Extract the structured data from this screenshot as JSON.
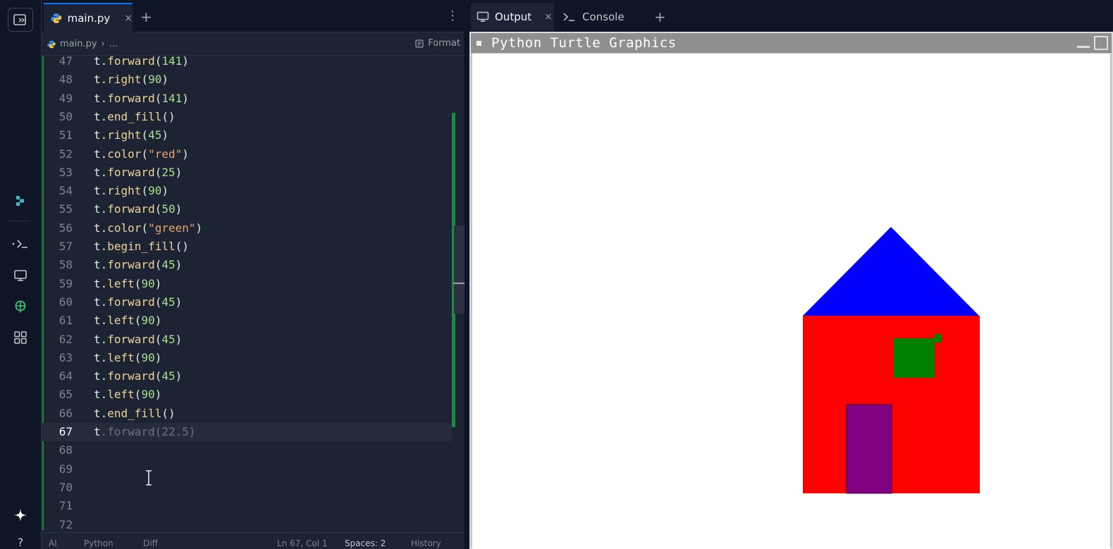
{
  "rail": {
    "icons": [
      "file-tree-icon",
      "replit-agent-icon",
      "shell-icon",
      "preview-icon",
      "web-globe-icon",
      "all-tools-icon",
      "sparkle-icon",
      "help-icon"
    ]
  },
  "editor": {
    "tab": {
      "label": "main.py",
      "close": "×"
    },
    "tab_add": "+",
    "menu": "⋮",
    "breadcrumb": {
      "file": "main.py",
      "sep": "›",
      "rest": "..."
    },
    "format_label": "Format",
    "lines": [
      {
        "n": "47",
        "parts": [
          [
            "obj",
            "t."
          ],
          [
            "fn",
            "forward"
          ],
          [
            "obj",
            "("
          ],
          [
            "num",
            "141"
          ],
          [
            "obj",
            ")"
          ]
        ]
      },
      {
        "n": "48",
        "parts": [
          [
            "obj",
            "t."
          ],
          [
            "fn",
            "right"
          ],
          [
            "obj",
            "("
          ],
          [
            "num",
            "90"
          ],
          [
            "obj",
            ")"
          ]
        ]
      },
      {
        "n": "49",
        "parts": [
          [
            "obj",
            "t."
          ],
          [
            "fn",
            "forward"
          ],
          [
            "obj",
            "("
          ],
          [
            "num",
            "141"
          ],
          [
            "obj",
            ")"
          ]
        ]
      },
      {
        "n": "50",
        "parts": [
          [
            "obj",
            "t."
          ],
          [
            "fn",
            "end_fill"
          ],
          [
            "obj",
            "()"
          ]
        ]
      },
      {
        "n": "51",
        "parts": [
          [
            "obj",
            "t."
          ],
          [
            "fn",
            "right"
          ],
          [
            "obj",
            "("
          ],
          [
            "num",
            "45"
          ],
          [
            "obj",
            ")"
          ]
        ]
      },
      {
        "n": "52",
        "parts": [
          [
            "obj",
            "t."
          ],
          [
            "fn",
            "color"
          ],
          [
            "obj",
            "("
          ],
          [
            "str",
            "\"red\""
          ],
          [
            "obj",
            ")"
          ]
        ]
      },
      {
        "n": "53",
        "parts": [
          [
            "obj",
            "t."
          ],
          [
            "fn",
            "forward"
          ],
          [
            "obj",
            "("
          ],
          [
            "num",
            "25"
          ],
          [
            "obj",
            ")"
          ]
        ]
      },
      {
        "n": "54",
        "parts": [
          [
            "obj",
            "t."
          ],
          [
            "fn",
            "right"
          ],
          [
            "obj",
            "("
          ],
          [
            "num",
            "90"
          ],
          [
            "obj",
            ")"
          ]
        ]
      },
      {
        "n": "55",
        "parts": [
          [
            "obj",
            "t."
          ],
          [
            "fn",
            "forward"
          ],
          [
            "obj",
            "("
          ],
          [
            "num",
            "50"
          ],
          [
            "obj",
            ")"
          ]
        ]
      },
      {
        "n": "56",
        "parts": [
          [
            "obj",
            "t."
          ],
          [
            "fn",
            "color"
          ],
          [
            "obj",
            "("
          ],
          [
            "str",
            "\"green\""
          ],
          [
            "obj",
            ")"
          ]
        ]
      },
      {
        "n": "57",
        "parts": [
          [
            "obj",
            "t."
          ],
          [
            "fn",
            "begin_fill"
          ],
          [
            "obj",
            "()"
          ]
        ]
      },
      {
        "n": "58",
        "parts": [
          [
            "obj",
            "t."
          ],
          [
            "fn",
            "forward"
          ],
          [
            "obj",
            "("
          ],
          [
            "num",
            "45"
          ],
          [
            "obj",
            ")"
          ]
        ]
      },
      {
        "n": "59",
        "parts": [
          [
            "obj",
            "t."
          ],
          [
            "fn",
            "left"
          ],
          [
            "obj",
            "("
          ],
          [
            "num",
            "90"
          ],
          [
            "obj",
            ")"
          ]
        ]
      },
      {
        "n": "60",
        "parts": [
          [
            "obj",
            "t."
          ],
          [
            "fn",
            "forward"
          ],
          [
            "obj",
            "("
          ],
          [
            "num",
            "45"
          ],
          [
            "obj",
            ")"
          ]
        ]
      },
      {
        "n": "61",
        "parts": [
          [
            "obj",
            "t."
          ],
          [
            "fn",
            "left"
          ],
          [
            "obj",
            "("
          ],
          [
            "num",
            "90"
          ],
          [
            "obj",
            ")"
          ]
        ]
      },
      {
        "n": "62",
        "parts": [
          [
            "obj",
            "t."
          ],
          [
            "fn",
            "forward"
          ],
          [
            "obj",
            "("
          ],
          [
            "num",
            "45"
          ],
          [
            "obj",
            ")"
          ]
        ]
      },
      {
        "n": "63",
        "parts": [
          [
            "obj",
            "t."
          ],
          [
            "fn",
            "left"
          ],
          [
            "obj",
            "("
          ],
          [
            "num",
            "90"
          ],
          [
            "obj",
            ")"
          ]
        ]
      },
      {
        "n": "64",
        "parts": [
          [
            "obj",
            "t."
          ],
          [
            "fn",
            "forward"
          ],
          [
            "obj",
            "("
          ],
          [
            "num",
            "45"
          ],
          [
            "obj",
            ")"
          ]
        ]
      },
      {
        "n": "65",
        "parts": [
          [
            "obj",
            "t."
          ],
          [
            "fn",
            "left"
          ],
          [
            "obj",
            "("
          ],
          [
            "num",
            "90"
          ],
          [
            "obj",
            ")"
          ]
        ]
      },
      {
        "n": "66",
        "parts": [
          [
            "obj",
            "t."
          ],
          [
            "fn",
            "end_fill"
          ],
          [
            "obj",
            "()"
          ]
        ]
      },
      {
        "n": "67",
        "active": true,
        "parts": [
          [
            "obj",
            "t"
          ],
          [
            "ghost",
            ".forward(22.5)"
          ]
        ]
      },
      {
        "n": "68",
        "parts": []
      },
      {
        "n": "69",
        "parts": []
      },
      {
        "n": "70",
        "parts": []
      },
      {
        "n": "71",
        "parts": []
      },
      {
        "n": "72",
        "parts": []
      }
    ],
    "status": {
      "ai": "AI",
      "language": "Python",
      "diff": "Diff",
      "position": "Ln 67, Col 1",
      "spaces": "Spaces: 2",
      "history": "History"
    }
  },
  "output": {
    "tab_output": "Output",
    "tab_output_close": "×",
    "tab_console": "Console",
    "tab_add": "+",
    "window_title": "Python Turtle Graphics",
    "drawing_colors": {
      "roof": "#0000ff",
      "walls": "#ff0000",
      "window": "#008000",
      "door": "#800080"
    }
  }
}
